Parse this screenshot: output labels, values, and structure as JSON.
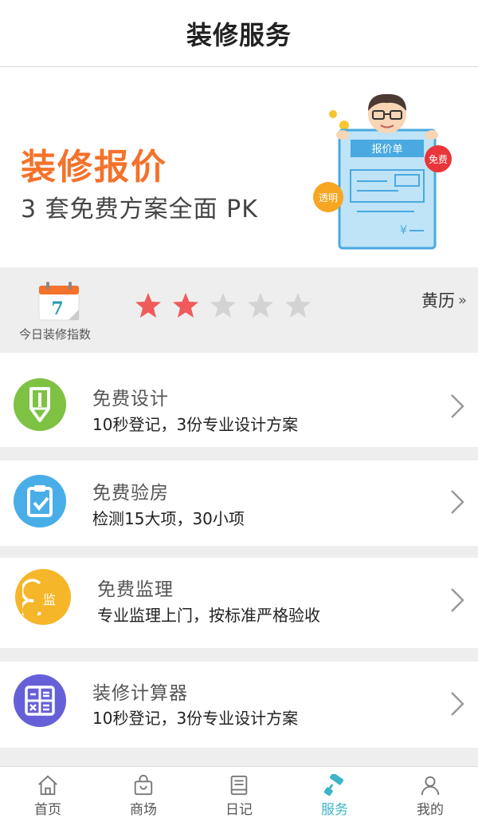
{
  "header": {
    "title": "装修服务"
  },
  "banner": {
    "title": "装修报价",
    "subtitle": "3 套免费方案全面 PK",
    "art": {
      "sheet_title": "报价单",
      "badge_free": "免费",
      "badge_transparent": "透明",
      "currency": "¥"
    }
  },
  "index": {
    "calendar_day": "7",
    "label": "今日装修指数",
    "rating": 2,
    "rating_max": 5,
    "almanac_label": "黄历",
    "almanac_icon": "»"
  },
  "services": [
    {
      "name": "免费设计",
      "desc": "10秒登记，3份专业设计方案",
      "icon": "pen-icon",
      "color": "#7dc243"
    },
    {
      "name": "免费验房",
      "desc": "检测15大项，30小项",
      "icon": "clipboard-check-icon",
      "color": "#49aee7"
    },
    {
      "name": "免费监理",
      "desc": "专业监理上门，按标准严格验收",
      "icon": "supervisor-icon",
      "color": "#f6b62a",
      "icon_text": "监"
    },
    {
      "name": "装修计算器",
      "desc": "10秒登记，3份专业设计方案",
      "icon": "calculator-icon",
      "color": "#6660d8"
    }
  ],
  "tabs": [
    {
      "label": "首页",
      "icon": "home-icon"
    },
    {
      "label": "商场",
      "icon": "shopping-bag-icon"
    },
    {
      "label": "日记",
      "icon": "diary-icon"
    },
    {
      "label": "服务",
      "icon": "roller-icon",
      "active": true
    },
    {
      "label": "我的",
      "icon": "user-icon"
    }
  ],
  "colors": {
    "accent": "#3cb4c9",
    "banner_title": "#f4722b",
    "star_on": "#ef5b5b",
    "star_off": "#d3d3d3"
  }
}
